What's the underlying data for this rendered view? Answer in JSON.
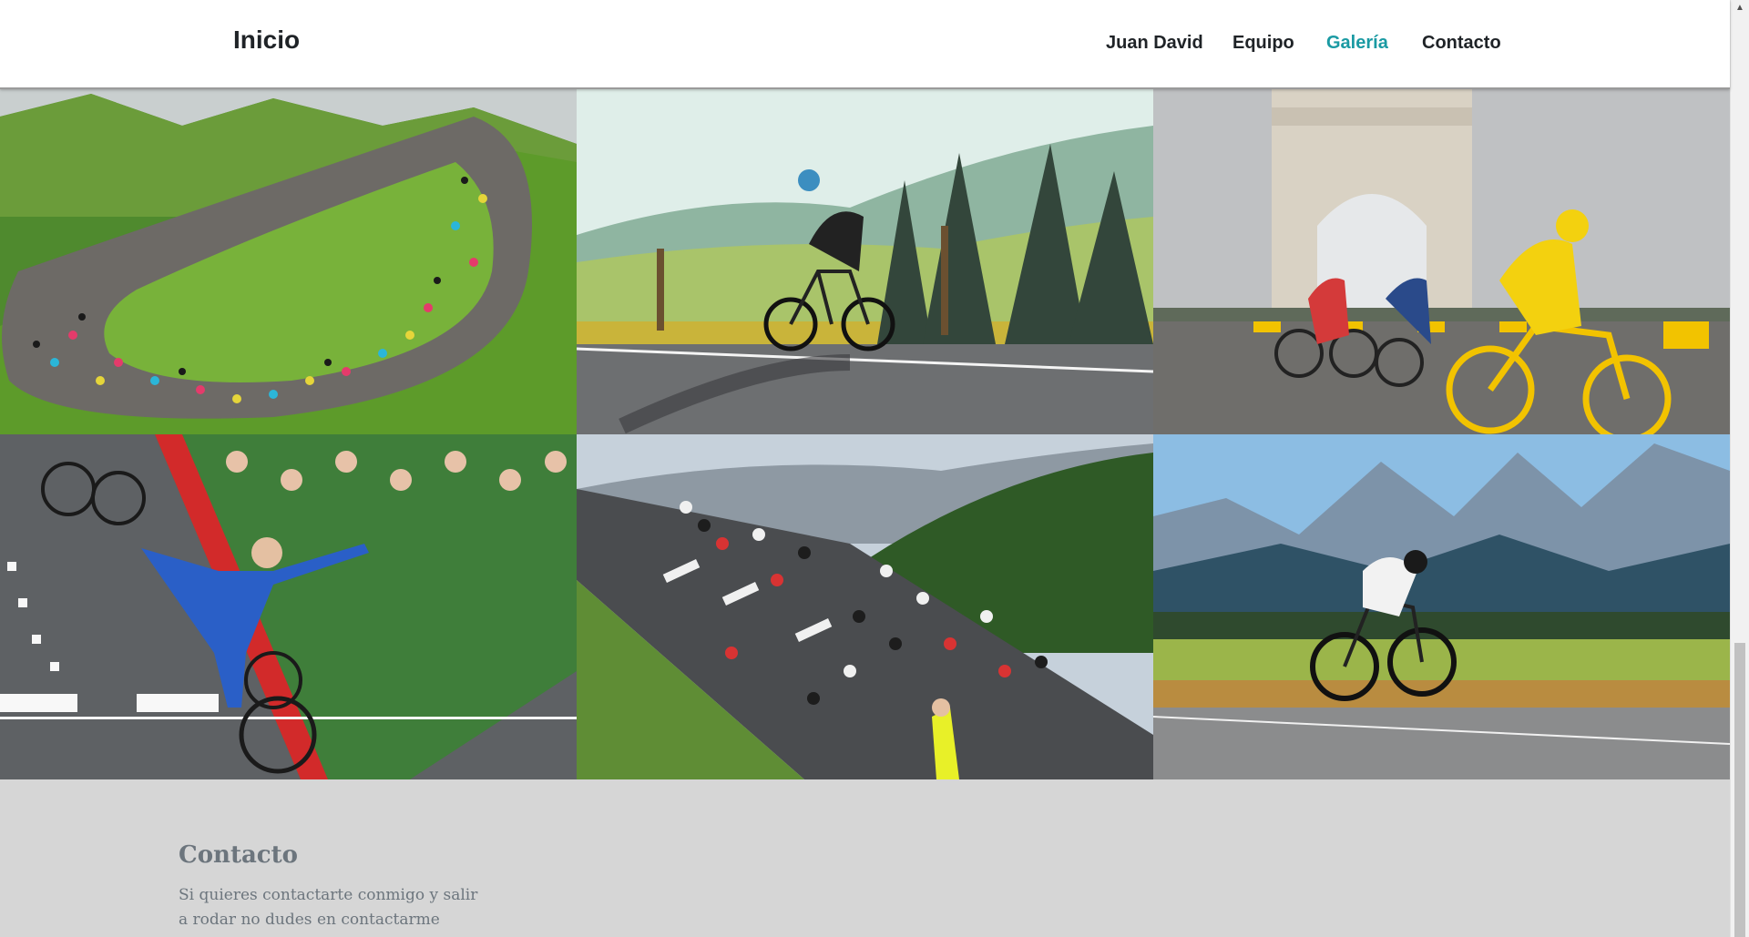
{
  "navbar": {
    "brand": "Inicio",
    "links": [
      {
        "label": "Juan David",
        "active": false
      },
      {
        "label": "Equipo",
        "active": false
      },
      {
        "label": "Galería",
        "active": true
      },
      {
        "label": "Contacto",
        "active": false
      }
    ],
    "active_color": "#1a9aa3"
  },
  "gallery": {
    "images": [
      {
        "subject": "peloton-mountain-road"
      },
      {
        "subject": "cyclist-countryside-road"
      },
      {
        "subject": "yellow-jersey-arc-de-triomphe"
      },
      {
        "subject": "winner-finish-line"
      },
      {
        "subject": "climb-crowd-mountain"
      },
      {
        "subject": "time-trial-mountains"
      }
    ]
  },
  "contact": {
    "title": "Contacto",
    "text": "Si quieres contactarte conmigo y salir a rodar no dudes en contactarme"
  },
  "scrollbar": {
    "up_icon": "chevron-up-icon"
  }
}
